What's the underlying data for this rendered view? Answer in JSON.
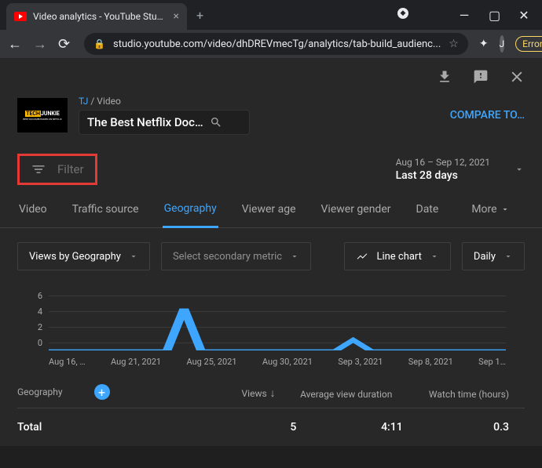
{
  "browser": {
    "tab_title": "Video analytics - YouTube Studio",
    "url": "studio.youtube.com/video/dhDREVmecTg/analytics/tab-build_audienc...",
    "avatar_initial": "J",
    "error_label": "Error"
  },
  "header": {
    "thumb_text1a": "TECH",
    "thumb_text1b": "JUNKIE",
    "thumb_text2": "BEST DOCUMENTARIES ON NETFLIX",
    "breadcrumb_channel": "TJ",
    "breadcrumb_sep": "/",
    "breadcrumb_video": "Video",
    "video_title": "The Best Netflix Doc…",
    "compare_label": "COMPARE TO…"
  },
  "filter": {
    "placeholder": "Filter"
  },
  "date": {
    "range": "Aug 16 – Sep 12, 2021",
    "period": "Last 28 days"
  },
  "tabs": {
    "items": [
      "Video",
      "Traffic source",
      "Geography",
      "Viewer age",
      "Viewer gender",
      "Date"
    ],
    "more": "More"
  },
  "controls": {
    "primary_metric": "Views by Geography",
    "secondary_metric": "Select secondary metric",
    "chart_type": "Line chart",
    "granularity": "Daily"
  },
  "table": {
    "headers": {
      "geo": "Geography",
      "views": "Views",
      "avg": "Average view duration",
      "watch": "Watch time (hours)"
    },
    "row": {
      "geo": "Total",
      "views": "5",
      "avg": "4:11",
      "watch": "0.3"
    }
  },
  "chart_data": {
    "type": "line",
    "title": "",
    "xlabel": "",
    "ylabel": "",
    "ylim": [
      0,
      6
    ],
    "y_ticks": [
      "6",
      "4",
      "2",
      "0"
    ],
    "x_ticks": [
      "Aug 16, …",
      "Aug 21, 2021",
      "Aug 25, 2021",
      "Aug 30, 2021",
      "Sep 3, 2021",
      "Sep 8, 2021",
      "Sep 1…"
    ],
    "series": [
      {
        "name": "Views by Geography",
        "x": [
          "Aug 16",
          "Aug 17",
          "Aug 18",
          "Aug 19",
          "Aug 20",
          "Aug 21",
          "Aug 22",
          "Aug 23",
          "Aug 24",
          "Aug 25",
          "Aug 26",
          "Aug 27",
          "Aug 28",
          "Aug 29",
          "Aug 30",
          "Aug 31",
          "Sep 1",
          "Sep 2",
          "Sep 3",
          "Sep 4",
          "Sep 5",
          "Sep 6",
          "Sep 7",
          "Sep 8",
          "Sep 9",
          "Sep 10",
          "Sep 11",
          "Sep 12"
        ],
        "values": [
          0,
          0,
          0,
          0,
          0,
          0,
          0,
          0,
          4,
          0,
          0,
          0,
          0,
          0,
          0,
          0,
          0,
          0,
          1,
          0,
          0,
          0,
          0,
          0,
          0,
          0,
          0,
          0
        ]
      }
    ]
  }
}
